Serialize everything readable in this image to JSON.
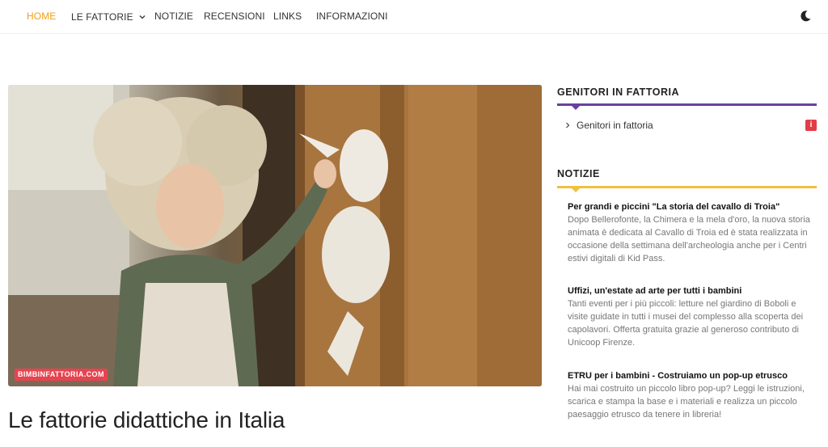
{
  "nav": {
    "items": [
      {
        "label": "HOME",
        "active": true
      },
      {
        "label": "LE FATTORIE",
        "has_dropdown": true
      },
      {
        "label": "NOTIZIE"
      },
      {
        "label": "RECENSIONI"
      },
      {
        "label": "LINKS"
      },
      {
        "label": "INFORMAZIONI"
      }
    ],
    "dark_mode_icon": "moon-icon",
    "active_color": "#f39c12"
  },
  "hero": {
    "tag": "BIMBINFATTORIA.COM",
    "tag_color": "#e8434f"
  },
  "post": {
    "title": "Le fattorie didattiche in Italia"
  },
  "sidebar": {
    "widget1": {
      "title": "GENITORI IN FATTORIA",
      "rule_color": "#6b3fa0",
      "link": "Genitori in fattoria",
      "badge": "i",
      "badge_color": "#e03d48"
    },
    "widget2": {
      "title": "NOTIZIE",
      "rule_color": "#f0c040",
      "items": [
        {
          "title": "Per grandi e piccini \"La storia del cavallo di Troia\"",
          "excerpt": "Dopo Bellerofonte, la Chimera e la mela d'oro, la nuova storia animata è dedicata al Cavallo di Troia ed è stata realizzata in occasione della settimana dell'archeologia anche per i Centri estivi digitali di Kid Pass."
        },
        {
          "title": "Uffizi, un'estate ad arte per tutti i bambini",
          "excerpt": "Tanti eventi per i più piccoli: letture nel giardino di Boboli e visite guidate in tutti i musei del complesso alla scoperta dei capolavori. Offerta gratuita grazie al generoso contributo di Unicoop Firenze."
        },
        {
          "title": "ETRU per i bambini - Costruiamo un pop-up etrusco",
          "excerpt": "Hai mai costruito un piccolo libro pop-up? Leggi le istruzioni, scarica e stampa la base e i materiali e realizza un piccolo paesaggio etrusco da tenere in libreria!"
        }
      ]
    }
  }
}
